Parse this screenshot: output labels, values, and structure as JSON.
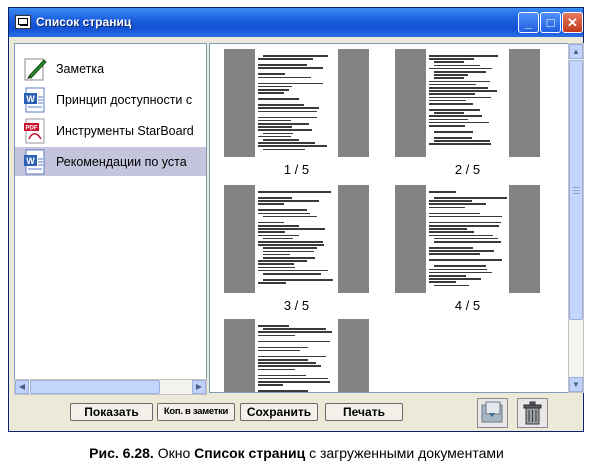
{
  "window": {
    "title": "Список страниц"
  },
  "titlebar_buttons": {
    "minimize": "_",
    "maximize": "□",
    "close": "✕"
  },
  "documents": [
    {
      "label": "Заметка",
      "icon": "note-pen-icon",
      "selected": false
    },
    {
      "label": "Принцип доступности с",
      "icon": "word-document-icon",
      "selected": false
    },
    {
      "label": "Инструменты StarBoard",
      "icon": "pdf-document-icon",
      "selected": false
    },
    {
      "label": "Рекомендации по уста",
      "icon": "word-document-icon",
      "selected": true
    }
  ],
  "pages": [
    {
      "label": "1 / 5"
    },
    {
      "label": "2 / 5"
    },
    {
      "label": "3 / 5"
    },
    {
      "label": "4 / 5"
    },
    {
      "label": ""
    }
  ],
  "buttons": {
    "show": "Показать",
    "copy_to_notes": "Коп. в заметки",
    "save": "Сохранить",
    "print": "Печать"
  },
  "icon_buttons": {
    "insert": "insert-page-icon",
    "delete": "trash-icon"
  },
  "caption": {
    "prefix": "Рис. 6.28.",
    "text1": " Окно ",
    "bold": "Список страниц",
    "text2": " с загруженными документами"
  },
  "colors": {
    "titlebar": "#1c5fdf",
    "selection": "#c4c4dc",
    "page_gray": "#838383"
  }
}
